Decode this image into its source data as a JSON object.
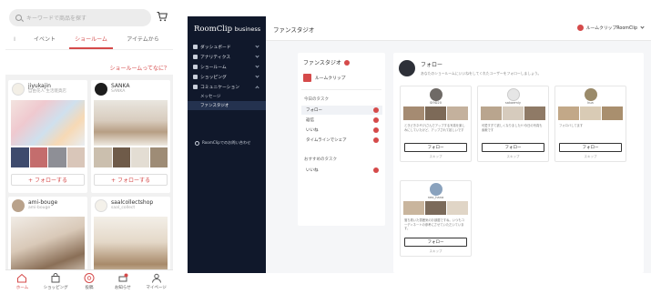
{
  "mobile": {
    "search_placeholder": "キーワードで商品を探す",
    "tabs": [
      "イベント",
      "ショールーム",
      "アイテムから"
    ],
    "what_link": "ショールームってなに？",
    "cards": [
      {
        "name": "jiyukajin",
        "sub": "自由花人 生活雑貨店",
        "follow": "+ フォローする"
      },
      {
        "name": "SANKA",
        "sub": "SANKA",
        "follow": "+ フォローする"
      },
      {
        "name": "ami-bouge",
        "sub": "ami-bouge"
      },
      {
        "name": "saalcollectshop",
        "sub": "saal_collect"
      }
    ],
    "nav": [
      "ホーム",
      "ショッピング",
      "投稿",
      "お知らせ",
      "マイページ"
    ]
  },
  "desktop": {
    "logo": "RoomClip",
    "logo_suffix": "business",
    "sidebar": [
      {
        "label": "ダッシュボード",
        "chevron": true
      },
      {
        "label": "アナリティクス",
        "chevron": true
      },
      {
        "label": "ショールーム",
        "chevron": true
      },
      {
        "label": "ショッピング",
        "chevron": true
      },
      {
        "label": "コミュニケーション",
        "chevron": true
      }
    ],
    "sidebar_sub": [
      "メッセージ",
      "ファンスタジオ"
    ],
    "sidebar_footer": "RoomClipでのお問い合わせ",
    "page_title": "ファンスタジオ",
    "account": "ルームクリップRoomClip",
    "tasks_title": "ファンスタジオ",
    "brand": "ルームクリップ",
    "today_section": "今日のタスク",
    "today_tasks": [
      "フォロー",
      "返信",
      "いいね",
      "タイムラインでシェア"
    ],
    "recommend_section": "おすすめのタスク",
    "recommend_tasks": [
      "いいね"
    ],
    "follow_title": "フォロー",
    "follow_desc": "あなたのショールームにいいねをしてくれたユーザーをフォローしましょう。",
    "users": [
      {
        "name": "SI9D20",
        "text": "ときどきネギ(?)さんでアップする写真を楽しみにしていたけど、アップされて嬉しいです",
        "button": "フォロー",
        "skip": "スキップ"
      },
      {
        "name": "sakaemiy",
        "text": "可愛すぎて欲しくなりました!!!今日の写真も素敵です",
        "button": "フォロー",
        "skip": "スキップ"
      },
      {
        "name": "kua",
        "text": "フォロバしてます",
        "button": "フォロー",
        "skip": "スキップ"
      },
      {
        "name": "neo_hana",
        "text": "落ち着いた雰囲気のお部屋ですね。いつもコーディネートの参考にさせていただいています。",
        "button": "フォロー",
        "skip": "スキップ"
      }
    ]
  },
  "colors": {
    "accent": "#d54a4a",
    "sidebar": "#10182b"
  }
}
